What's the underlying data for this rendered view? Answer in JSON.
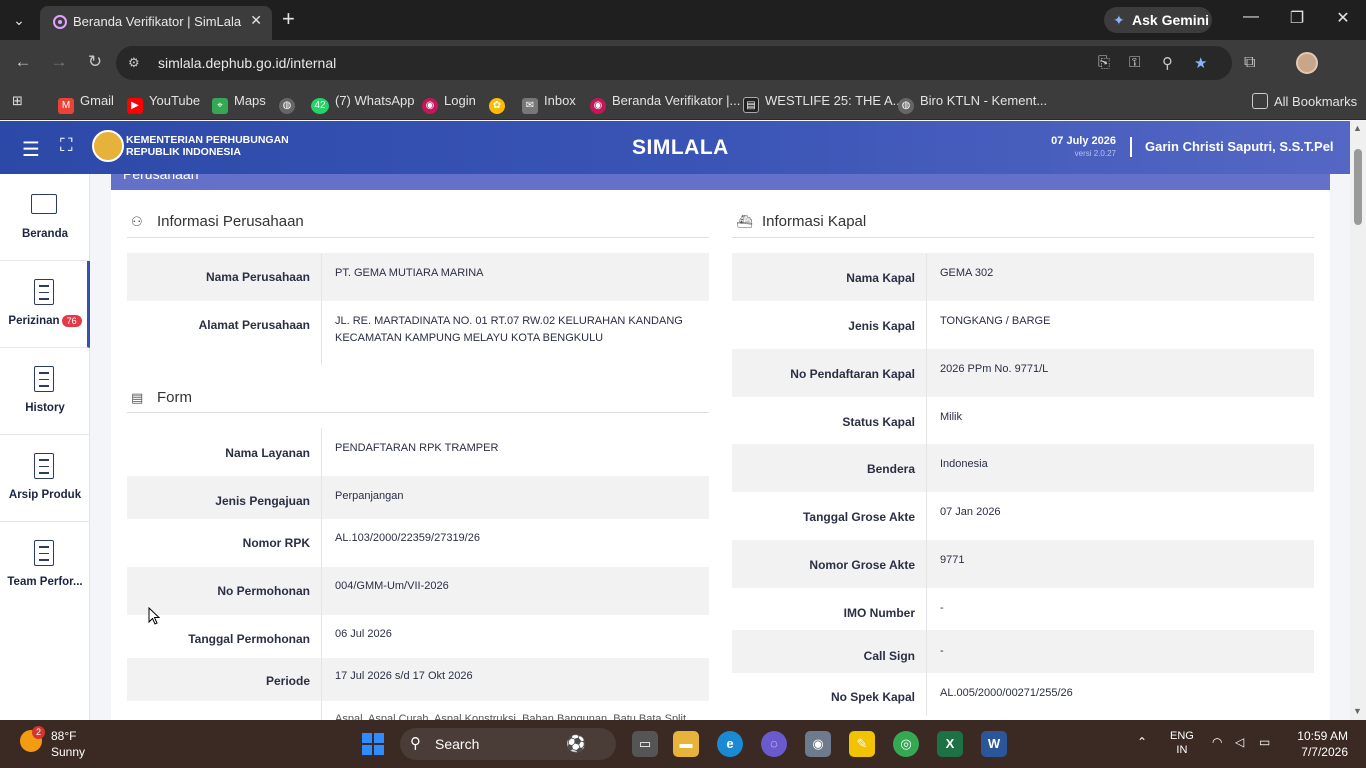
{
  "browser": {
    "tab_title": "Beranda Verifikator | SimLala",
    "url": "simlala.dephub.go.id/internal",
    "ask_gemini": "Ask Gemini",
    "bookmarks": [
      {
        "label": "Gmail",
        "color": "#ea4335"
      },
      {
        "label": "YouTube",
        "color": "#ff0000"
      },
      {
        "label": "Maps",
        "color": "#34a853"
      },
      {
        "label": "",
        "color": "#888888"
      },
      {
        "label": "(7) WhatsApp",
        "color": "#25d366",
        "badge": "42"
      },
      {
        "label": "Login",
        "color": "#c2185b"
      },
      {
        "label": "",
        "color": "#fbbc05"
      },
      {
        "label": "Inbox",
        "color": "#777777"
      },
      {
        "label": "Beranda Verifikator |...",
        "color": "#c2185b"
      },
      {
        "label": "WESTLIFE 25: THE A...",
        "color": "#444444"
      },
      {
        "label": "Biro KTLN - Kement...",
        "color": "#888888"
      }
    ],
    "all_bookmarks": "All Bookmarks"
  },
  "app": {
    "title": "SIMLALA",
    "logo_line1": "KEMENTERIAN PERHUBUNGAN",
    "logo_line2": "REPUBLIK INDONESIA",
    "date": "07 July 2026",
    "version": "versi 2.0.27",
    "user": "Garin Christi Saputri, S.S.T.Pel"
  },
  "sidebar": {
    "items": [
      {
        "label": "Beranda"
      },
      {
        "label": "Perizinan",
        "badge": "76"
      },
      {
        "label": "History"
      },
      {
        "label": "Arsip Produk"
      },
      {
        "label": "Team Perfor..."
      }
    ]
  },
  "panel": {
    "title": "Perusahaan"
  },
  "company": {
    "section_title": "Informasi Perusahaan",
    "rows": [
      {
        "label": "Nama Perusahaan",
        "value": "PT. GEMA MUTIARA MARINA"
      },
      {
        "label": "Alamat Perusahaan",
        "value": "JL. RE. MARTADINATA NO. 01 RT.07 RW.02 KELURAHAN KANDANG KECAMATAN KAMPUNG MELAYU KOTA BENGKULU"
      }
    ]
  },
  "form": {
    "section_title": "Form",
    "rows": [
      {
        "label": "Nama Layanan",
        "value": "PENDAFTARAN RPK TRAMPER"
      },
      {
        "label": "Jenis Pengajuan",
        "value": "Perpanjangan"
      },
      {
        "label": "Nomor RPK",
        "value": "AL.103/2000/22359/27319/26"
      },
      {
        "label": "No Permohonan",
        "value": "004/GMM-Um/VII-2026"
      },
      {
        "label": "Tanggal Permohonan",
        "value": "06 Jul 2026"
      },
      {
        "label": "Periode",
        "value": "17 Jul 2026 s/d 17 Okt 2026"
      },
      {
        "label": "",
        "value": "Aspal, Aspal Curah, Aspal Konstruksi, Bahan Bangunan, Batu Bata Split"
      }
    ]
  },
  "ship": {
    "section_title": "Informasi Kapal",
    "rows": [
      {
        "label": "Nama Kapal",
        "value": "GEMA 302"
      },
      {
        "label": "Jenis Kapal",
        "value": "TONGKANG / BARGE"
      },
      {
        "label": "No Pendaftaran Kapal",
        "value": "2026 PPm No. 9771/L"
      },
      {
        "label": "Status Kapal",
        "value": "Milik"
      },
      {
        "label": "Bendera",
        "value": "Indonesia"
      },
      {
        "label": "Tanggal Grose Akte",
        "value": "07 Jan 2026"
      },
      {
        "label": "Nomor Grose Akte",
        "value": "9771"
      },
      {
        "label": "IMO Number",
        "value": "-"
      },
      {
        "label": "Call Sign",
        "value": "-"
      },
      {
        "label": "No Spek Kapal",
        "value": "AL.005/2000/00271/255/26"
      }
    ]
  },
  "taskbar": {
    "weather_badge": "2",
    "temp": "88°F",
    "weather": "Sunny",
    "search": "Search",
    "lang1": "ENG",
    "lang2": "IN",
    "time": "10:59 AM",
    "date": "7/7/2026"
  }
}
